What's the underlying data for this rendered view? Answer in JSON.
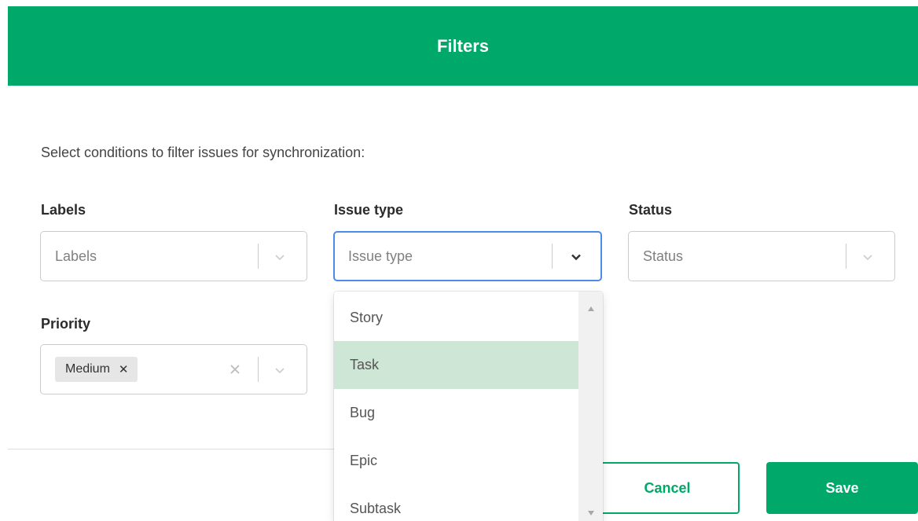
{
  "header": {
    "title": "Filters"
  },
  "intro": "Select conditions to filter issues for synchronization:",
  "fields": {
    "labels": {
      "label": "Labels",
      "placeholder": "Labels"
    },
    "issue_type": {
      "label": "Issue type",
      "placeholder": "Issue type"
    },
    "status": {
      "label": "Status",
      "placeholder": "Status"
    },
    "priority": {
      "label": "Priority",
      "selected_tag": "Medium"
    }
  },
  "dropdown": {
    "options": [
      "Story",
      "Task",
      "Bug",
      "Epic",
      "Subtask"
    ],
    "highlighted": "Task"
  },
  "buttons": {
    "cancel": "Cancel",
    "save": "Save"
  },
  "colors": {
    "brand": "#00a869",
    "focus_border": "#4a8bea",
    "option_highlight": "#cde6d6"
  },
  "icons": [
    "chevron-down-icon",
    "close-icon",
    "scroll-up-icon",
    "scroll-down-icon"
  ]
}
